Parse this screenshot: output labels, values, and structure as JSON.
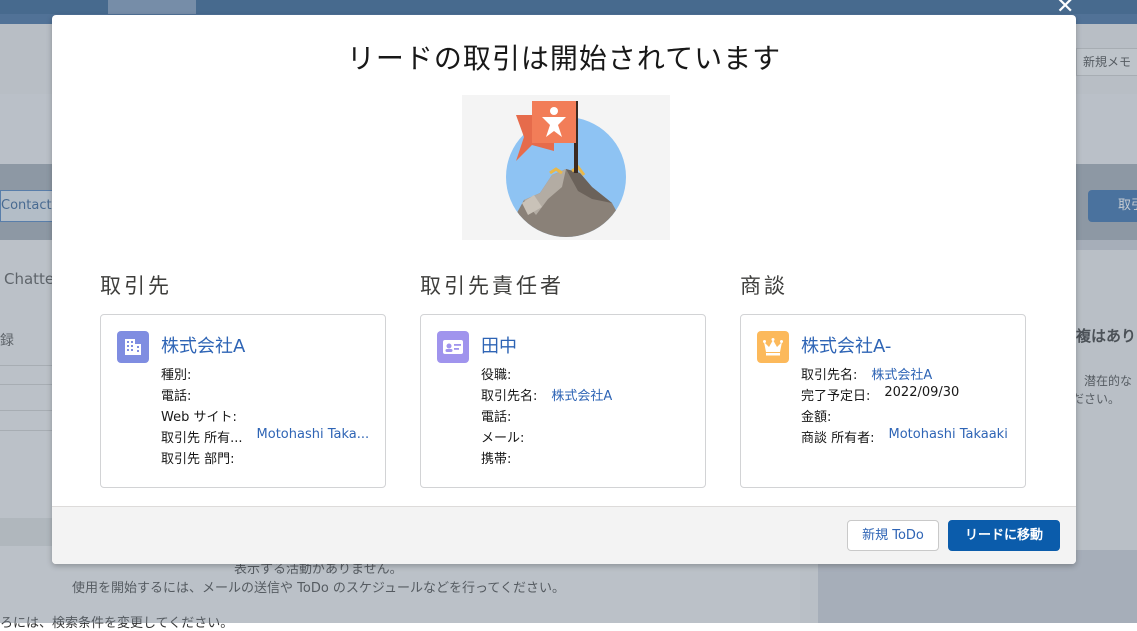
{
  "background": {
    "path_stage": "Contacted",
    "chatter_tab": "Chatter",
    "kiroku_label": "録",
    "new_memo_button": "新規メモ",
    "primary_button_partial": "取引",
    "empty_activity_1": "表示する活動がありません。",
    "empty_activity_2": "使用を開始するには、メールの送信や ToDo のスケジュールなどを行ってください。",
    "filter_hint": "ろには、検索条件を変更してください。",
    "duplicates_title": "複はあり",
    "duplicates_text_1": "、潜在的な",
    "duplicates_text_2": "ださい。"
  },
  "modal": {
    "title": "リードの取引は開始されています",
    "sections": {
      "account": {
        "label": "取引先",
        "icon": "building-icon",
        "icon_color": "#7f8de1",
        "name": "株式会社A",
        "rows": [
          {
            "k": "種別:",
            "v": ""
          },
          {
            "k": "電話:",
            "v": ""
          },
          {
            "k": "Web サイト:",
            "v": ""
          },
          {
            "k": "取引先 所有...",
            "v": "Motohashi Taka..."
          },
          {
            "k": "取引先 部門:",
            "v": ""
          }
        ]
      },
      "contact": {
        "label": "取引先責任者",
        "icon": "contact-card-icon",
        "icon_color": "#a094ed",
        "name": "田中",
        "rows": [
          {
            "k": "役職:",
            "v": ""
          },
          {
            "k": "取引先名:",
            "v": "株式会社A"
          },
          {
            "k": "電話:",
            "v": ""
          },
          {
            "k": "メール:",
            "v": ""
          },
          {
            "k": "携帯:",
            "v": ""
          }
        ]
      },
      "opportunity": {
        "label": "商談",
        "icon": "crown-icon",
        "icon_color": "#fcb95b",
        "name": "株式会社A-",
        "rows": [
          {
            "k": "取引先名:",
            "v": "株式会社A"
          },
          {
            "k": "完了予定日:",
            "v": "2022/09/30"
          },
          {
            "k": "金額:",
            "v": ""
          },
          {
            "k": "商談 所有者:",
            "v": "Motohashi Takaaki"
          }
        ]
      }
    },
    "footer": {
      "new_todo": "新規 ToDo",
      "go_to_leads": "リードに移動"
    }
  }
}
